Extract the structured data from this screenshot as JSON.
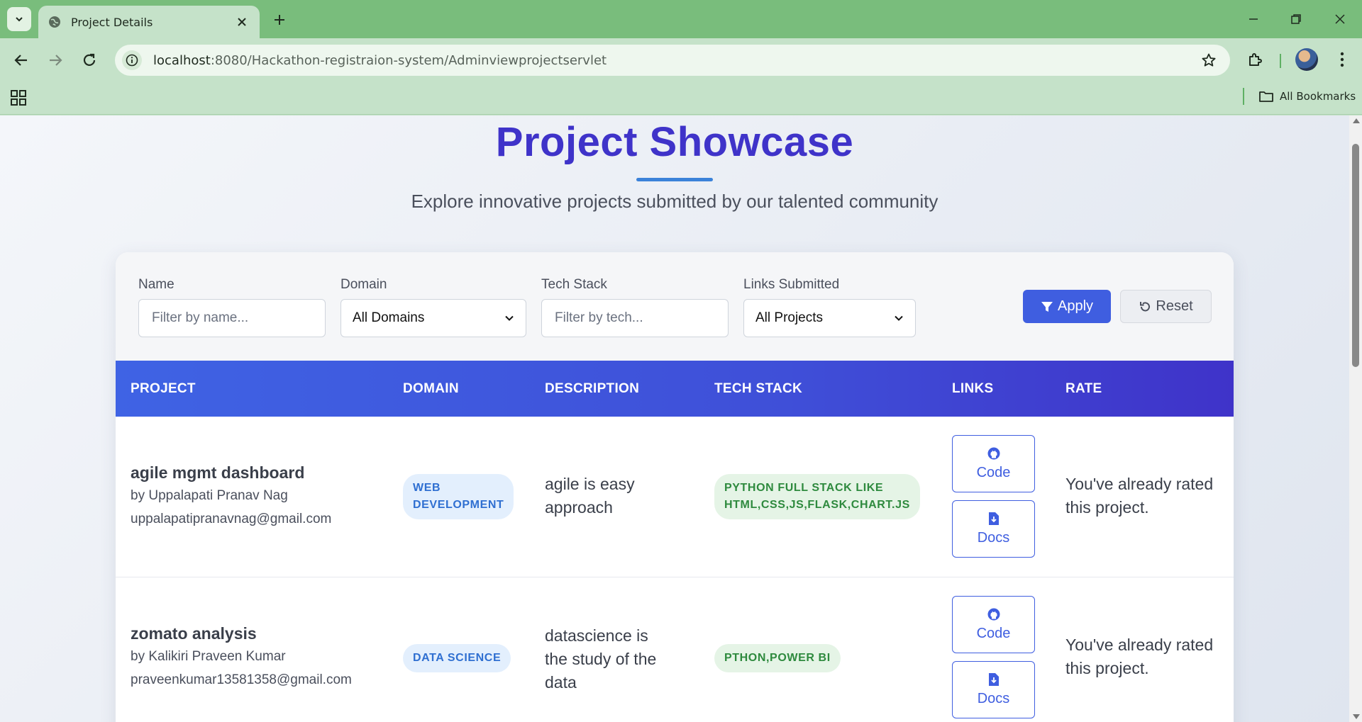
{
  "browser": {
    "tab_title": "Project Details",
    "url_host": "localhost",
    "url_path": ":8080/Hackathon-registraion-system/Adminviewprojectservlet",
    "all_bookmarks_label": "All Bookmarks"
  },
  "page": {
    "title": "Project Showcase",
    "subtitle": "Explore innovative projects submitted by our talented community"
  },
  "filters": {
    "name_label": "Name",
    "name_placeholder": "Filter by name...",
    "domain_label": "Domain",
    "domain_selected": "All Domains",
    "tech_label": "Tech Stack",
    "tech_placeholder": "Filter by tech...",
    "links_label": "Links Submitted",
    "links_selected": "All Projects",
    "apply_label": "Apply",
    "reset_label": "Reset"
  },
  "table": {
    "headers": [
      "PROJECT",
      "DOMAIN",
      "DESCRIPTION",
      "TECH STACK",
      "LINKS",
      "RATE"
    ],
    "rows": [
      {
        "name": "agile mgmt dashboard",
        "by": "by Uppalapati Pranav Nag",
        "email": "uppalapatipranavnag@gmail.com",
        "domain_line1": "WEB",
        "domain_line2": "DEVELOPMENT",
        "description": "agile is easy approach",
        "tech_line1": "PYTHON FULL STACK LIKE",
        "tech_line2": "HTML,CSS,JS,FLASK,CHART.JS",
        "code_label": "Code",
        "docs_label": "Docs",
        "rate_text": "You've already rated this project."
      },
      {
        "name": "zomato analysis",
        "by": "by Kalikiri Praveen Kumar",
        "email": "praveenkumar13581358@gmail.com",
        "domain_line1": "DATA SCIENCE",
        "domain_line2": "",
        "description": "datascience is the study of the data",
        "tech_line1": "PTHON,POWER BI",
        "tech_line2": "",
        "code_label": "Code",
        "docs_label": "Docs",
        "rate_text": "You've already rated this project."
      }
    ]
  }
}
